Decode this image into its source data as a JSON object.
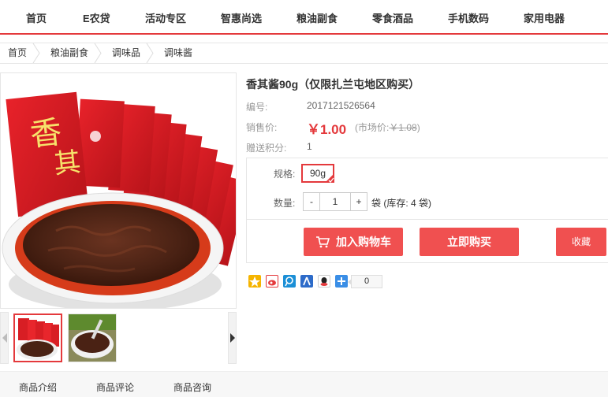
{
  "nav": {
    "items": [
      {
        "label": "首页"
      },
      {
        "label": "E农贷"
      },
      {
        "label": "活动专区"
      },
      {
        "label": "智惠尚选"
      },
      {
        "label": "粮油副食"
      },
      {
        "label": "零食酒品"
      },
      {
        "label": "手机数码"
      },
      {
        "label": "家用电器"
      }
    ]
  },
  "breadcrumb": [
    "首页",
    "粮油副食",
    "调味品",
    "调味酱"
  ],
  "product": {
    "title": "香其酱90g（仅限扎兰屯地区购买）",
    "sku_label": "编号:",
    "sku": "2017121526564",
    "price_label": "销售价:",
    "price": "￥1.00",
    "market_prefix": "(市场价:",
    "market_price": "￥1.08",
    "market_suffix": ")",
    "points_label": "赠送积分:",
    "points": "1",
    "spec_label": "规格:",
    "spec_value": "90g",
    "qty_label": "数量:",
    "qty_minus": "-",
    "qty_value": "1",
    "qty_plus": "+",
    "stock_text": "袋 (库存: 4 袋)"
  },
  "buttons": {
    "add_cart": "加入购物车",
    "buy_now": "立即购买",
    "favorite": "收藏"
  },
  "share": {
    "count": "0"
  },
  "tabs": [
    "商品介绍",
    "商品评论",
    "商品咨询"
  ],
  "colors": {
    "accent": "#e4393c",
    "button": "#f05050"
  }
}
